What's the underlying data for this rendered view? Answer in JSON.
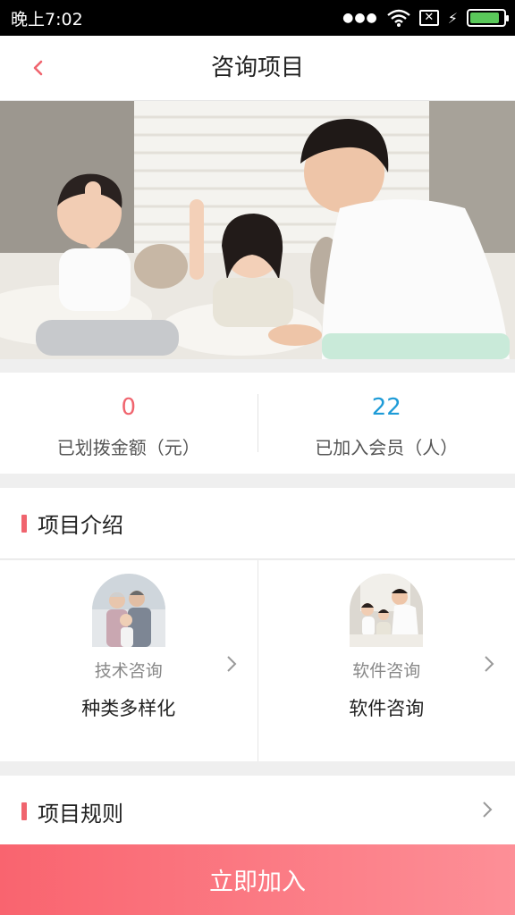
{
  "status_bar": {
    "time": "晚上7:02",
    "icons": [
      "signal-icon",
      "wifi-icon",
      "sim-icon",
      "charging-icon",
      "battery-icon"
    ],
    "battery_level": 0.9
  },
  "nav": {
    "title": "咨询项目",
    "back_icon": "chevron-left-icon",
    "accent": "#f0646e"
  },
  "stats": [
    {
      "value": "0",
      "label": "已划拨金额（元）",
      "color": "#f0646e"
    },
    {
      "value": "22",
      "label": "已加入会员（人）",
      "color": "#1e9bd7"
    }
  ],
  "intro": {
    "title": "项目介绍",
    "cards": [
      {
        "sub": "技术咨询",
        "title": "种类多样化",
        "icon": "family-photo"
      },
      {
        "sub": "软件咨询",
        "title": "软件咨询",
        "icon": "family-photo"
      }
    ]
  },
  "rules": {
    "title": "项目规则"
  },
  "cta": {
    "label": "立即加入"
  }
}
